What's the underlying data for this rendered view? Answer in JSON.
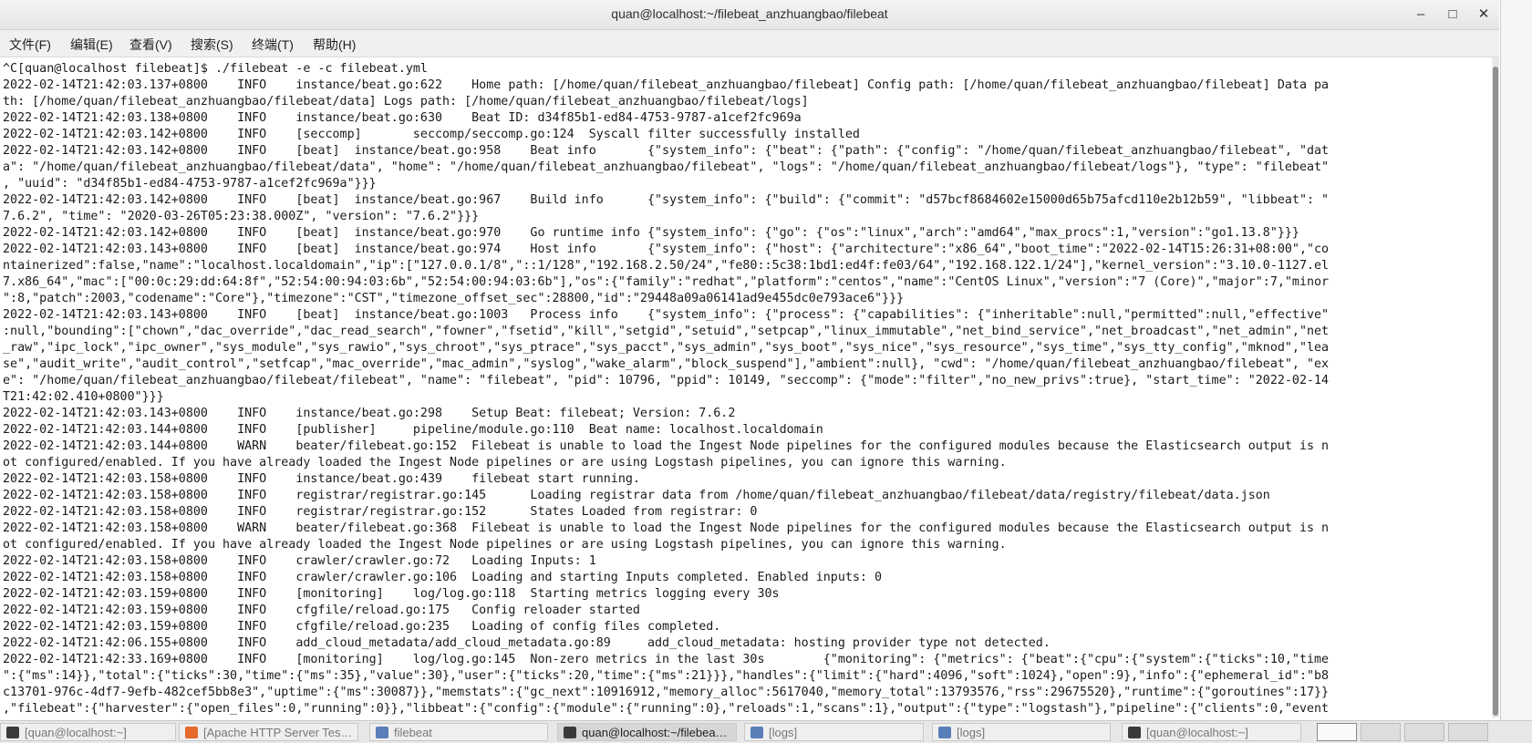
{
  "window": {
    "title": "quan@localhost:~/filebeat_anzhuangbao/filebeat",
    "controls": {
      "minimize": "–",
      "maximize": "□",
      "close": "✕"
    }
  },
  "menubar": {
    "items": [
      "文件(F)",
      "编辑(E)",
      "查看(V)",
      "搜索(S)",
      "终端(T)",
      "帮助(H)"
    ]
  },
  "terminal": {
    "lines": [
      "^C[quan@localhost filebeat]$ ./filebeat -e -c filebeat.yml",
      "2022-02-14T21:42:03.137+0800    INFO    instance/beat.go:622    Home path: [/home/quan/filebeat_anzhuangbao/filebeat] Config path: [/home/quan/filebeat_anzhuangbao/filebeat] Data pa",
      "th: [/home/quan/filebeat_anzhuangbao/filebeat/data] Logs path: [/home/quan/filebeat_anzhuangbao/filebeat/logs]",
      "2022-02-14T21:42:03.138+0800    INFO    instance/beat.go:630    Beat ID: d34f85b1-ed84-4753-9787-a1cef2fc969a",
      "2022-02-14T21:42:03.142+0800    INFO    [seccomp]       seccomp/seccomp.go:124  Syscall filter successfully installed",
      "2022-02-14T21:42:03.142+0800    INFO    [beat]  instance/beat.go:958    Beat info       {\"system_info\": {\"beat\": {\"path\": {\"config\": \"/home/quan/filebeat_anzhuangbao/filebeat\", \"dat",
      "a\": \"/home/quan/filebeat_anzhuangbao/filebeat/data\", \"home\": \"/home/quan/filebeat_anzhuangbao/filebeat\", \"logs\": \"/home/quan/filebeat_anzhuangbao/filebeat/logs\"}, \"type\": \"filebeat\"",
      ", \"uuid\": \"d34f85b1-ed84-4753-9787-a1cef2fc969a\"}}}",
      "2022-02-14T21:42:03.142+0800    INFO    [beat]  instance/beat.go:967    Build info      {\"system_info\": {\"build\": {\"commit\": \"d57bcf8684602e15000d65b75afcd110e2b12b59\", \"libbeat\": \"",
      "7.6.2\", \"time\": \"2020-03-26T05:23:38.000Z\", \"version\": \"7.6.2\"}}}",
      "2022-02-14T21:42:03.142+0800    INFO    [beat]  instance/beat.go:970    Go runtime info {\"system_info\": {\"go\": {\"os\":\"linux\",\"arch\":\"amd64\",\"max_procs\":1,\"version\":\"go1.13.8\"}}}",
      "2022-02-14T21:42:03.143+0800    INFO    [beat]  instance/beat.go:974    Host info       {\"system_info\": {\"host\": {\"architecture\":\"x86_64\",\"boot_time\":\"2022-02-14T15:26:31+08:00\",\"co",
      "ntainerized\":false,\"name\":\"localhost.localdomain\",\"ip\":[\"127.0.0.1/8\",\"::1/128\",\"192.168.2.50/24\",\"fe80::5c38:1bd1:ed4f:fe03/64\",\"192.168.122.1/24\"],\"kernel_version\":\"3.10.0-1127.el",
      "7.x86_64\",\"mac\":[\"00:0c:29:dd:64:8f\",\"52:54:00:94:03:6b\",\"52:54:00:94:03:6b\"],\"os\":{\"family\":\"redhat\",\"platform\":\"centos\",\"name\":\"CentOS Linux\",\"version\":\"7 (Core)\",\"major\":7,\"minor",
      "\":8,\"patch\":2003,\"codename\":\"Core\"},\"timezone\":\"CST\",\"timezone_offset_sec\":28800,\"id\":\"29448a09a06141ad9e455dc0e793ace6\"}}}",
      "2022-02-14T21:42:03.143+0800    INFO    [beat]  instance/beat.go:1003   Process info    {\"system_info\": {\"process\": {\"capabilities\": {\"inheritable\":null,\"permitted\":null,\"effective\"",
      ":null,\"bounding\":[\"chown\",\"dac_override\",\"dac_read_search\",\"fowner\",\"fsetid\",\"kill\",\"setgid\",\"setuid\",\"setpcap\",\"linux_immutable\",\"net_bind_service\",\"net_broadcast\",\"net_admin\",\"net",
      "_raw\",\"ipc_lock\",\"ipc_owner\",\"sys_module\",\"sys_rawio\",\"sys_chroot\",\"sys_ptrace\",\"sys_pacct\",\"sys_admin\",\"sys_boot\",\"sys_nice\",\"sys_resource\",\"sys_time\",\"sys_tty_config\",\"mknod\",\"lea",
      "se\",\"audit_write\",\"audit_control\",\"setfcap\",\"mac_override\",\"mac_admin\",\"syslog\",\"wake_alarm\",\"block_suspend\"],\"ambient\":null}, \"cwd\": \"/home/quan/filebeat_anzhuangbao/filebeat\", \"ex",
      "e\": \"/home/quan/filebeat_anzhuangbao/filebeat/filebeat\", \"name\": \"filebeat\", \"pid\": 10796, \"ppid\": 10149, \"seccomp\": {\"mode\":\"filter\",\"no_new_privs\":true}, \"start_time\": \"2022-02-14",
      "T21:42:02.410+0800\"}}}",
      "2022-02-14T21:42:03.143+0800    INFO    instance/beat.go:298    Setup Beat: filebeat; Version: 7.6.2",
      "2022-02-14T21:42:03.144+0800    INFO    [publisher]     pipeline/module.go:110  Beat name: localhost.localdomain",
      "2022-02-14T21:42:03.144+0800    WARN    beater/filebeat.go:152  Filebeat is unable to load the Ingest Node pipelines for the configured modules because the Elasticsearch output is n",
      "ot configured/enabled. If you have already loaded the Ingest Node pipelines or are using Logstash pipelines, you can ignore this warning.",
      "2022-02-14T21:42:03.158+0800    INFO    instance/beat.go:439    filebeat start running.",
      "2022-02-14T21:42:03.158+0800    INFO    registrar/registrar.go:145      Loading registrar data from /home/quan/filebeat_anzhuangbao/filebeat/data/registry/filebeat/data.json",
      "2022-02-14T21:42:03.158+0800    INFO    registrar/registrar.go:152      States Loaded from registrar: 0",
      "2022-02-14T21:42:03.158+0800    WARN    beater/filebeat.go:368  Filebeat is unable to load the Ingest Node pipelines for the configured modules because the Elasticsearch output is n",
      "ot configured/enabled. If you have already loaded the Ingest Node pipelines or are using Logstash pipelines, you can ignore this warning.",
      "2022-02-14T21:42:03.158+0800    INFO    crawler/crawler.go:72   Loading Inputs: 1",
      "2022-02-14T21:42:03.158+0800    INFO    crawler/crawler.go:106  Loading and starting Inputs completed. Enabled inputs: 0",
      "2022-02-14T21:42:03.159+0800    INFO    [monitoring]    log/log.go:118  Starting metrics logging every 30s",
      "2022-02-14T21:42:03.159+0800    INFO    cfgfile/reload.go:175   Config reloader started",
      "2022-02-14T21:42:03.159+0800    INFO    cfgfile/reload.go:235   Loading of config files completed.",
      "2022-02-14T21:42:06.155+0800    INFO    add_cloud_metadata/add_cloud_metadata.go:89     add_cloud_metadata: hosting provider type not detected.",
      "2022-02-14T21:42:33.169+0800    INFO    [monitoring]    log/log.go:145  Non-zero metrics in the last 30s        {\"monitoring\": {\"metrics\": {\"beat\":{\"cpu\":{\"system\":{\"ticks\":10,\"time",
      "\":{\"ms\":14}},\"total\":{\"ticks\":30,\"time\":{\"ms\":35},\"value\":30},\"user\":{\"ticks\":20,\"time\":{\"ms\":21}}},\"handles\":{\"limit\":{\"hard\":4096,\"soft\":1024},\"open\":9},\"info\":{\"ephemeral_id\":\"b8",
      "c13701-976c-4df7-9efb-482cef5bb8e3\",\"uptime\":{\"ms\":30087}},\"memstats\":{\"gc_next\":10916912,\"memory_alloc\":5617040,\"memory_total\":13793576,\"rss\":29675520},\"runtime\":{\"goroutines\":17}}",
      ",\"filebeat\":{\"harvester\":{\"open_files\":0,\"running\":0}},\"libbeat\":{\"config\":{\"module\":{\"running\":0},\"reloads\":1,\"scans\":1},\"output\":{\"type\":\"logstash\"},\"pipeline\":{\"clients\":0,\"event"
    ]
  },
  "taskbar": {
    "tasks": [
      {
        "label": "[quan@localhost:~]",
        "icon": "terminal-icon",
        "active": false
      },
      {
        "label": "[Apache HTTP Server Tes…",
        "icon": "firefox-icon",
        "active": false
      },
      {
        "label": "filebeat",
        "icon": "folder-icon",
        "active": false
      },
      {
        "label": "quan@localhost:~/filebea…",
        "icon": "terminal-icon",
        "active": true
      },
      {
        "label": "[logs]",
        "icon": "folder-icon",
        "active": false
      },
      {
        "label": "[logs]",
        "icon": "folder-icon",
        "active": false
      },
      {
        "label": "[quan@localhost:~]",
        "icon": "terminal-icon",
        "active": false
      }
    ],
    "colors": {
      "terminal": "#3a3a3a",
      "firefox": "#e66a2c",
      "folder": "#5a7fb8"
    }
  }
}
